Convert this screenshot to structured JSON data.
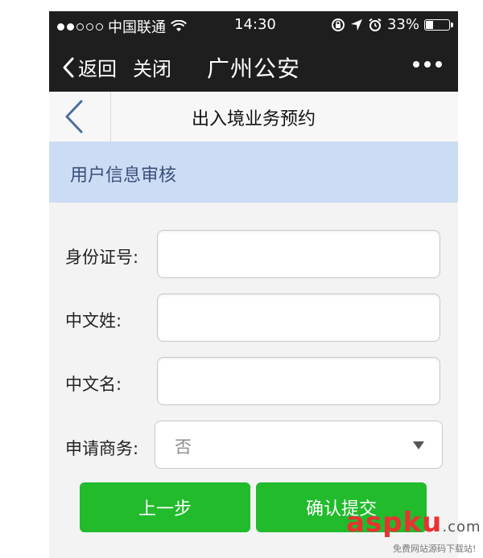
{
  "status_bar": {
    "carrier": "中国联通",
    "time": "14:30",
    "battery": "33%",
    "battery_level": 0.33
  },
  "nav": {
    "back_label": "返回",
    "close_label": "关闭",
    "title": "广州公安"
  },
  "page": {
    "title": "出入境业务预约"
  },
  "section": {
    "title": "用户信息审核"
  },
  "form": {
    "id_label": "身份证号:",
    "id_value": "",
    "surname_label": "中文姓:",
    "surname_value": "",
    "given_name_label": "中文名:",
    "given_name_value": "",
    "business_label": "申请商务:",
    "business_value": "否"
  },
  "buttons": {
    "prev_label": "上一步",
    "submit_label": "确认提交"
  },
  "watermark": {
    "brand": "aspku",
    "domain": ".com",
    "tagline": "免费网站源码下载站!"
  },
  "colors": {
    "nav_bg": "#1e1e1e",
    "banner_bg": "#ccdcf5",
    "button_green": "#21bb2c"
  }
}
